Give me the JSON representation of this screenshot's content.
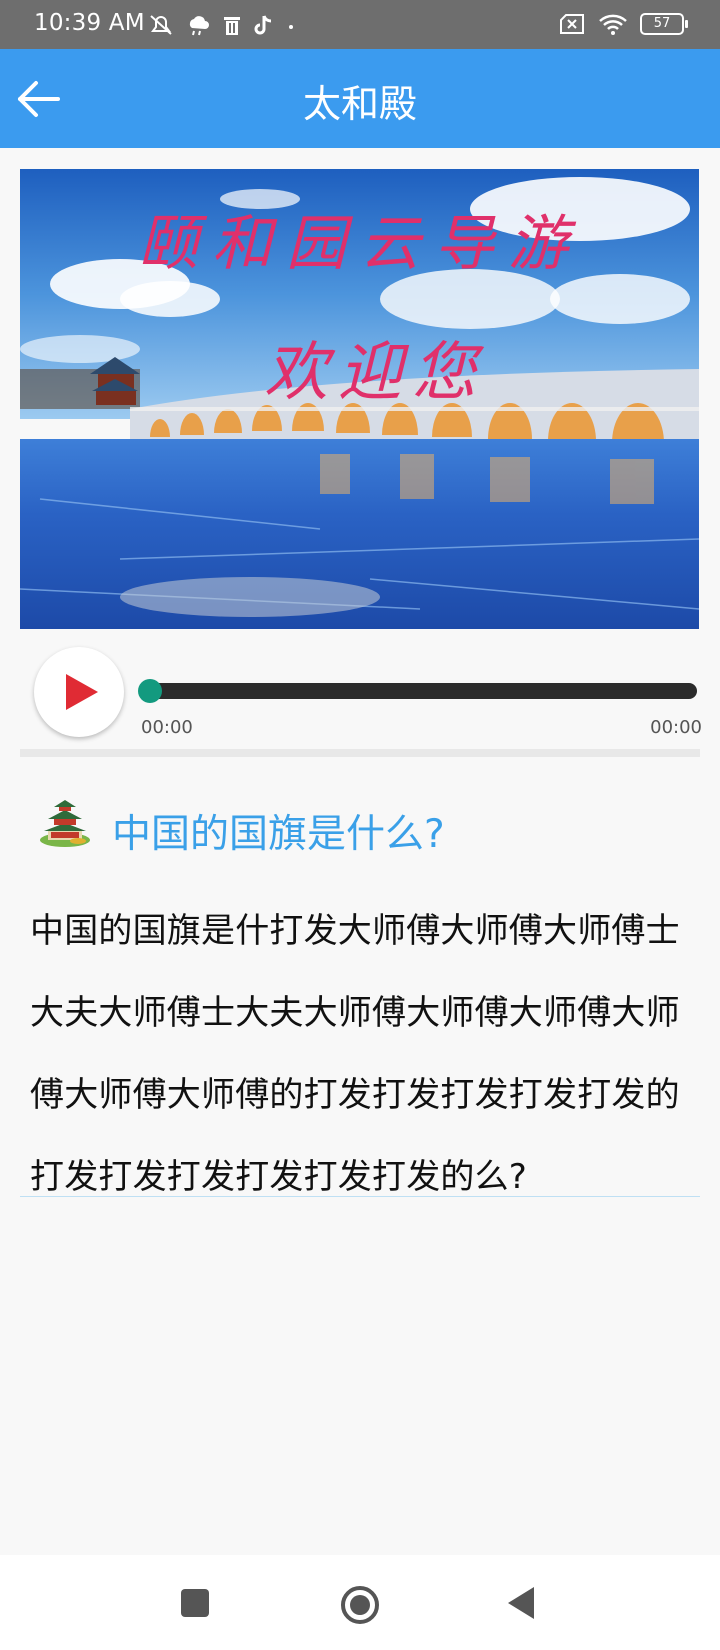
{
  "status_bar": {
    "time": "10:39 AM",
    "battery_level": "57",
    "icons": [
      "mute-icon",
      "cloud-icon",
      "trash-icon",
      "tiktok-icon",
      "dot-icon",
      "sim-error-icon",
      "wifi-icon",
      "battery-icon"
    ]
  },
  "app_bar": {
    "title": "太和殿",
    "back_icon": "arrow-left-icon"
  },
  "banner": {
    "headline": "颐和园云导游",
    "subline": "欢迎您"
  },
  "player": {
    "current_time": "00:00",
    "total_time": "00:00",
    "progress": 0,
    "play_icon": "play-icon",
    "accent_color": "#139a7f",
    "play_color": "#e02b34"
  },
  "question": {
    "icon": "pagoda-icon",
    "title": "中国的国旗是什么?",
    "body": "中国的国旗是什打发大师傅大师傅大师傅士大夫大师傅士大夫大师傅大师傅大师傅大师傅大师傅大师傅的打发打发打发打发打发的打发打发打发打发打发打发的么?",
    "title_color": "#3aa0e8"
  },
  "nav_bar": {
    "recent_icon": "square-icon",
    "home_icon": "circle-icon",
    "back_icon": "triangle-back-icon"
  },
  "colors": {
    "app_bar": "#3b9bef",
    "status_bar": "#6e6e6e",
    "background": "#f8f8f8"
  }
}
